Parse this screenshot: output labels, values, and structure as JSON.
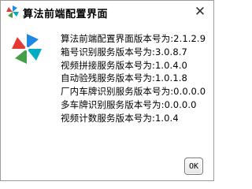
{
  "window": {
    "title": "算法前端配置界面",
    "icon": "pinwheel-icon",
    "close_icon": "close-icon"
  },
  "about": {
    "lines": [
      "算法前端配置界面版本号为:2.1.2.9",
      "箱号识别服务版本号为:3.0.8.7",
      "视频拼接服务版本号为:1.0.4.0",
      "自动验残服务版本号为:1.0.1.8",
      "厂内车牌识别服务版本号为:0.0.0.0",
      "多车牌识别服务版本号为:0.0.0.0",
      "视频计数服务版本号为:1.0.4"
    ]
  },
  "buttons": {
    "ok_label": "OK"
  },
  "colors": {
    "pinwheel": [
      "#1e88e5",
      "#43a047",
      "#e53935",
      "#00acc1"
    ]
  }
}
